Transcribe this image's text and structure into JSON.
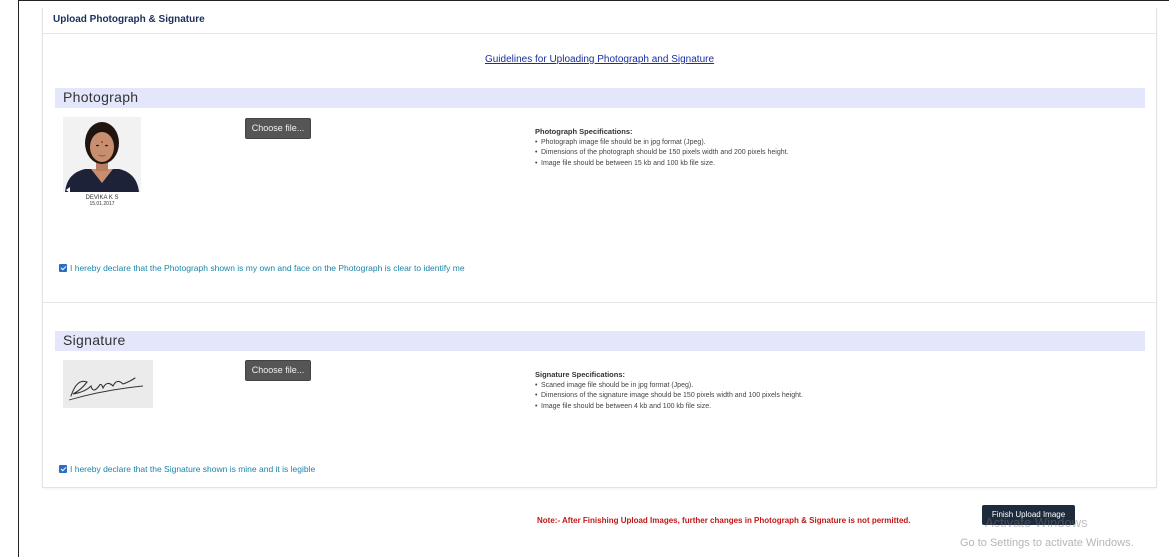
{
  "panel": {
    "title": "Upload Photograph & Signature",
    "guidelines_link": "Guidelines for Uploading Photograph and Signature"
  },
  "photograph": {
    "heading": "Photograph",
    "choose_label": "Choose file...",
    "caption_name": "DEVIKA K S",
    "caption_date": "15.01.2017",
    "specs_title": "Photograph Specifications:",
    "specs": [
      "Photograph image file should be in jpg format (Jpeg).",
      "Dimensions of the photograph should be 150 pixels width and 200 pixels height.",
      "Image file should be between 15 kb and 100 kb file size."
    ],
    "declaration": "I hereby declare that the Photograph shown is my own and face on the Photograph is clear to identify me"
  },
  "signature": {
    "heading": "Signature",
    "choose_label": "Choose file...",
    "specs_title": "Signature Specifications:",
    "specs": [
      "Scaned image file should be in jpg format (Jpeg).",
      "Dimensions of the signature image should be 150 pixels width and 100 pixels height.",
      "Image file should be between 4 kb and 100 kb file size."
    ],
    "declaration": "I hereby declare that the Signature shown is mine and it is legible"
  },
  "footer": {
    "note": "Note:- After Finishing Upload Images, further changes in Photograph & Signature is not permitted.",
    "finish_label": "Finish Upload Image"
  },
  "os_watermark": {
    "line1": "Activate Windows",
    "line2": "Go to Settings to activate Windows."
  },
  "colors": {
    "section_bar": "#e4e7fb",
    "link": "#1a2ea0",
    "declaration_text": "#1b84a8",
    "note_text": "#c01818",
    "finish_button": "#1e2b3c",
    "choose_button": "#555555"
  }
}
